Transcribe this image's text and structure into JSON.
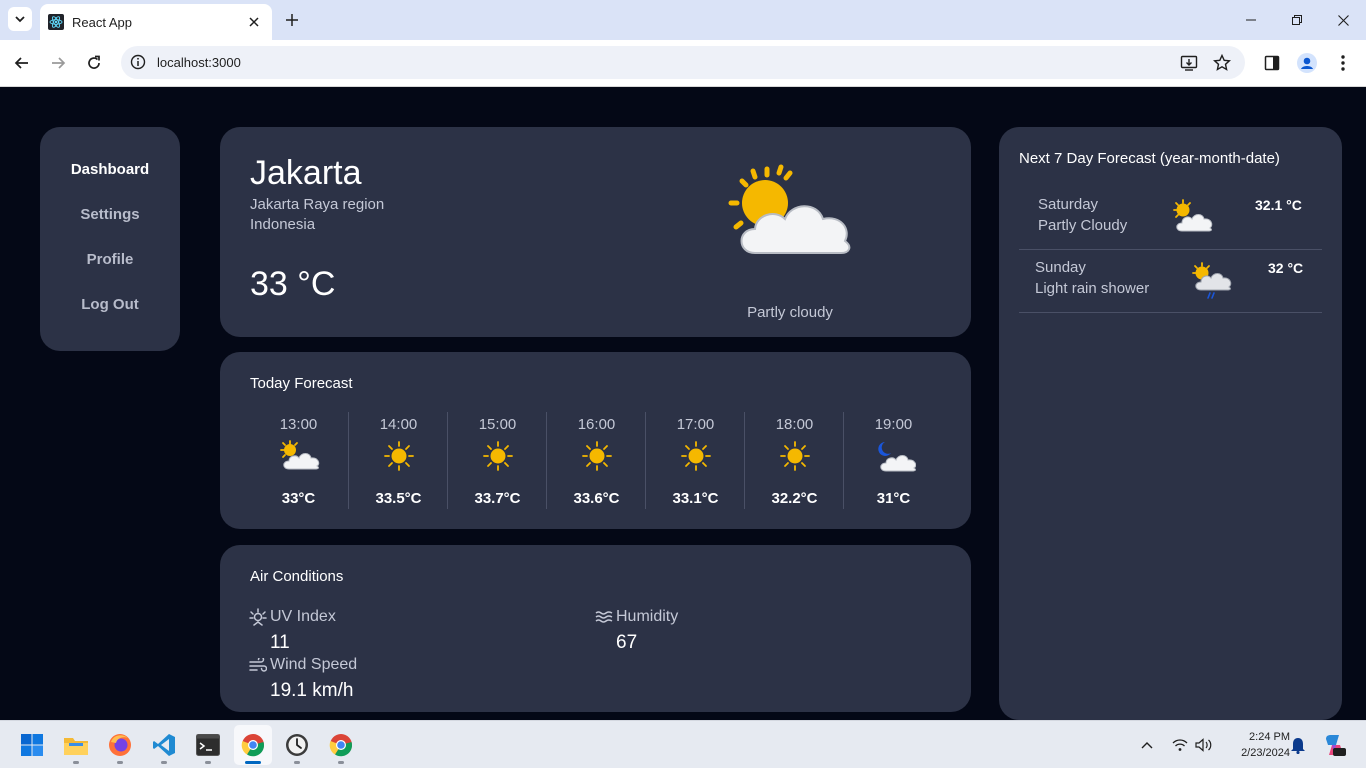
{
  "browser": {
    "tab_title": "React App",
    "url": "localhost:3000"
  },
  "sidebar": {
    "items": [
      {
        "label": "Dashboard",
        "active": true
      },
      {
        "label": "Settings",
        "active": false
      },
      {
        "label": "Profile",
        "active": false
      },
      {
        "label": "Log Out",
        "active": false
      }
    ]
  },
  "current": {
    "city": "Jakarta",
    "region": "Jakarta Raya region",
    "country": "Indonesia",
    "temperature": "33 °C",
    "condition": "Partly cloudy",
    "icon": "partly-cloudy-icon"
  },
  "today": {
    "title": "Today Forecast",
    "hours": [
      {
        "time": "13:00",
        "temp": "33°C",
        "icon": "partly-cloudy-icon"
      },
      {
        "time": "14:00",
        "temp": "33.5°C",
        "icon": "sun-icon"
      },
      {
        "time": "15:00",
        "temp": "33.7°C",
        "icon": "sun-icon"
      },
      {
        "time": "16:00",
        "temp": "33.6°C",
        "icon": "sun-icon"
      },
      {
        "time": "17:00",
        "temp": "33.1°C",
        "icon": "sun-icon"
      },
      {
        "time": "18:00",
        "temp": "32.2°C",
        "icon": "sun-icon"
      },
      {
        "time": "19:00",
        "temp": "31°C",
        "icon": "moon-cloud-icon"
      }
    ]
  },
  "air": {
    "title": "Air Conditions",
    "uv_label": "UV Index",
    "uv_value": "11",
    "humidity_label": "Humidity",
    "humidity_value": "67",
    "wind_label": "Wind Speed",
    "wind_value": "19.1 km/h"
  },
  "weekly": {
    "title": "Next 7 Day Forecast (year-month-date)",
    "days": [
      {
        "day": "Saturday",
        "condition": "Partly Cloudy",
        "temp": "32.1 °C",
        "icon": "partly-cloudy-icon"
      },
      {
        "day": "Sunday",
        "condition": "Light rain shower",
        "temp": "32 °C",
        "icon": "rain-shower-icon"
      }
    ]
  },
  "taskbar": {
    "time": "2:24 PM",
    "date": "2/23/2024"
  },
  "colors": {
    "app_bg": "#040816",
    "card_bg": "#2c3246",
    "text_primary": "#ffffff",
    "text_secondary": "#c4c8d6",
    "sun": "#f5b800"
  }
}
